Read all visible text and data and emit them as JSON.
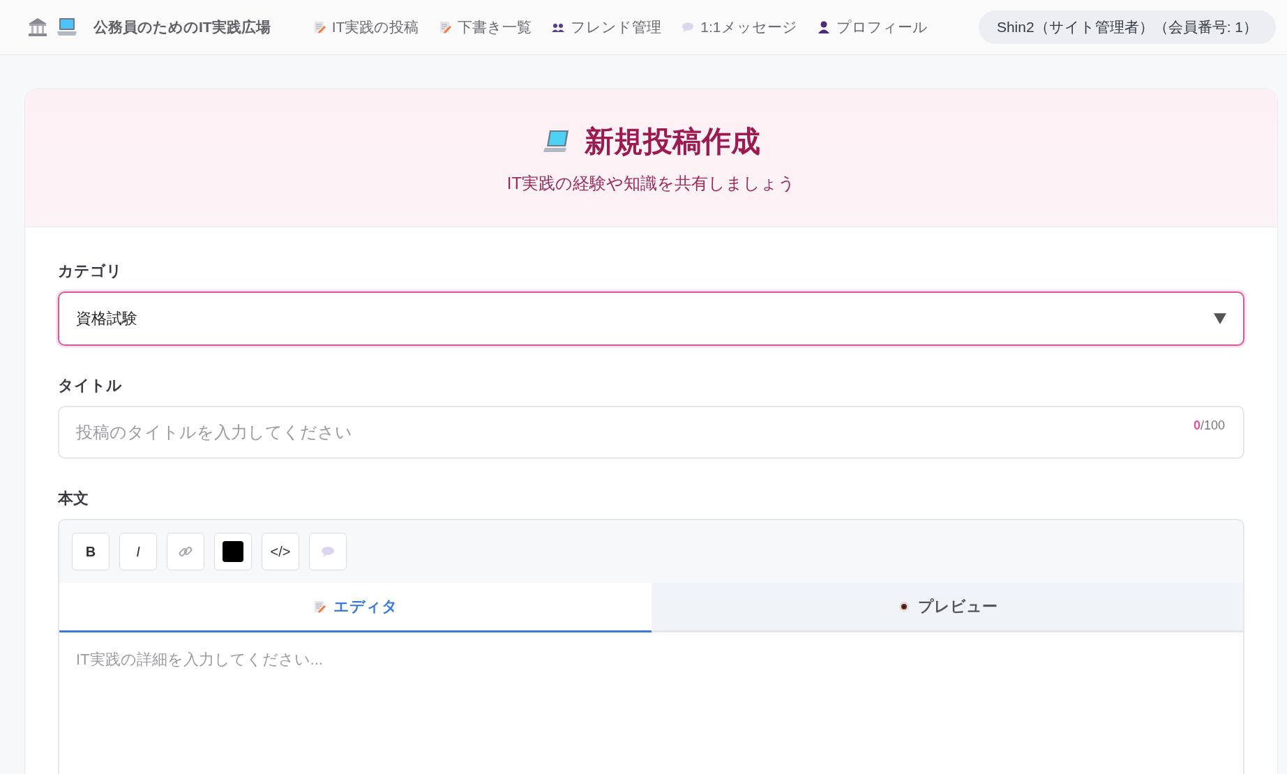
{
  "header": {
    "site_title": "公務員のためのIT実践広場",
    "nav": [
      {
        "kind": "memo",
        "label": "IT実践の投稿"
      },
      {
        "kind": "memo",
        "label": "下書き一覧"
      },
      {
        "kind": "people",
        "label": "フレンド管理"
      },
      {
        "kind": "speech",
        "label": "1:1メッセージ"
      },
      {
        "kind": "person",
        "label": "プロフィール"
      }
    ],
    "user": "Shin2（サイト管理者）（会員番号: 1）"
  },
  "page": {
    "title": "新規投稿作成",
    "subtitle": "IT実践の経験や知識を共有しましょう"
  },
  "form": {
    "category": {
      "label": "カテゴリ",
      "value": "資格試験",
      "focused": true
    },
    "title": {
      "label": "タイトル",
      "placeholder": "投稿のタイトルを入力してください",
      "counter": "**0**/100"
    },
    "body": {
      "label": "本文",
      "toolbar": [
        {
          "kind": "bold",
          "text": "B"
        },
        {
          "kind": "italic",
          "text": "I"
        },
        {
          "kind": "link"
        },
        {
          "kind": "color",
          "color": "#000000"
        },
        {
          "kind": "code",
          "text": "</>"
        },
        {
          "kind": "speech"
        }
      ],
      "tabs": [
        {
          "kind": "memo",
          "label": "エディタ",
          "selected": true
        },
        {
          "kind": "eye",
          "label": "プレビュー",
          "selected": false
        }
      ],
      "placeholder": "IT実践の詳細を入力してください..."
    }
  }
}
